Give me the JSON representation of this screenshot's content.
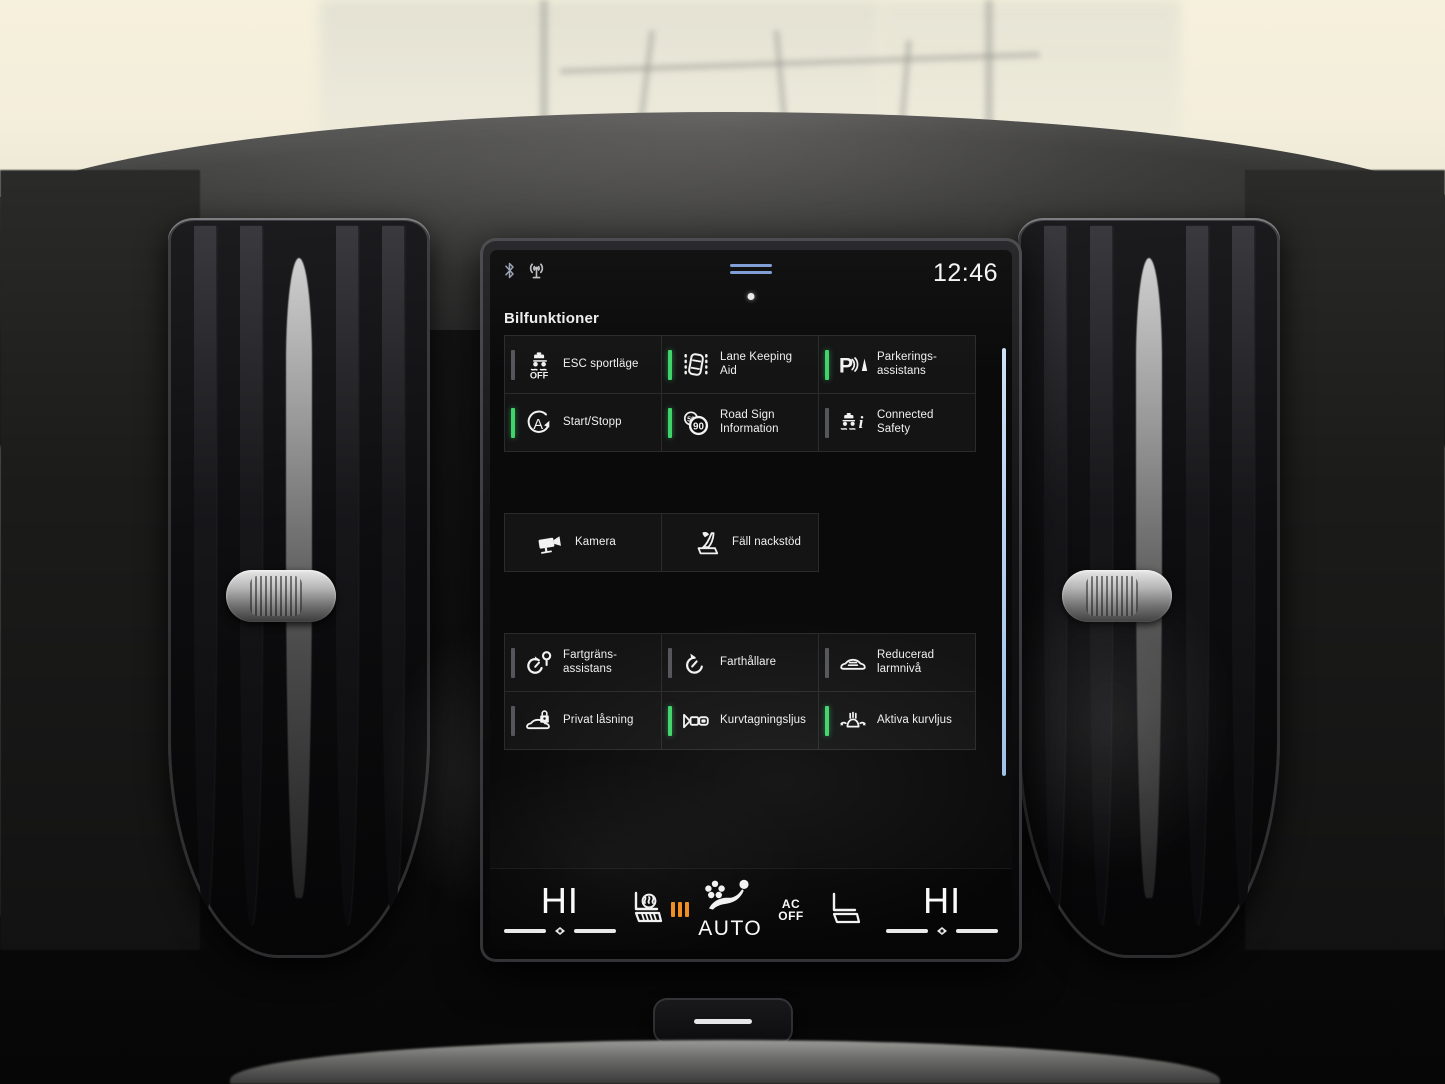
{
  "statusbar": {
    "bluetooth_icon": "bluetooth-icon",
    "antenna_icon": "antenna-icon",
    "drag_handle_icon": "drag-handle-icon",
    "clock": "12:46"
  },
  "page": {
    "title": "Bilfunktioner"
  },
  "colors": {
    "indicator_on": "#3fd46a",
    "indicator_off": "#55565b",
    "scrollbar": "#cfe0f7",
    "seat_heat": "#ef8b1c",
    "handle": "#7d9bd6"
  },
  "tiles": {
    "group_top": [
      {
        "label": "ESC sportläge",
        "icon": "esc-off-icon",
        "state": "off",
        "bar": "off"
      },
      {
        "label": "Lane Keeping\nAid",
        "icon": "lane-keeping-aid-icon",
        "state": "on",
        "bar": "on"
      },
      {
        "label": "Parkerings-\nassistans",
        "icon": "park-assist-icon",
        "state": "on",
        "bar": "on"
      },
      {
        "label": "Start/Stopp",
        "icon": "start-stop-icon",
        "state": "on",
        "bar": "on"
      },
      {
        "label": "Road Sign\nInformation",
        "icon": "road-sign-90-icon",
        "state": "on",
        "bar": "on"
      },
      {
        "label": "Connected\nSafety",
        "icon": "connected-safety-icon",
        "state": "off",
        "bar": "off"
      }
    ],
    "group_middle": [
      {
        "label": "Kamera",
        "icon": "camera-icon",
        "state": "none",
        "bar": "none"
      },
      {
        "label": "Fäll nackstöd",
        "icon": "fold-headrest-icon",
        "state": "none",
        "bar": "none"
      }
    ],
    "group_bottom": [
      {
        "label": "Fartgräns-\nassistans",
        "icon": "speed-limiter-icon",
        "state": "off",
        "bar": "off"
      },
      {
        "label": "Farthållare",
        "icon": "cruise-control-icon",
        "state": "off",
        "bar": "off"
      },
      {
        "label": "Reducerad\nlarmnivå",
        "icon": "reduced-alarm-icon",
        "state": "off",
        "bar": "off"
      },
      {
        "label": "Privat låsning",
        "icon": "private-locking-icon",
        "state": "off",
        "bar": "off"
      },
      {
        "label": "Kurvtagningsljus",
        "icon": "cornering-light-icon",
        "state": "on",
        "bar": "on"
      },
      {
        "label": "Aktiva kurvljus",
        "icon": "active-bending-light-icon",
        "state": "on",
        "bar": "on"
      }
    ]
  },
  "climate": {
    "left_temp": "HI",
    "right_temp": "HI",
    "left_seat_heat_icon": "heated-seat-icon",
    "left_seat_heat_level": 3,
    "right_seat_icon": "seat-icon",
    "auto_icon": "auto-airflow-icon",
    "auto_label": "AUTO",
    "ac_label_top": "AC",
    "ac_label_bottom": "OFF",
    "left_slider_icon": "temp-slider-icon",
    "right_slider_icon": "temp-slider-icon"
  },
  "hardware": {
    "home_button": "home-button",
    "vent_left": "air-vent-left",
    "vent_right": "air-vent-right",
    "vent_knob": "vent-knob"
  }
}
